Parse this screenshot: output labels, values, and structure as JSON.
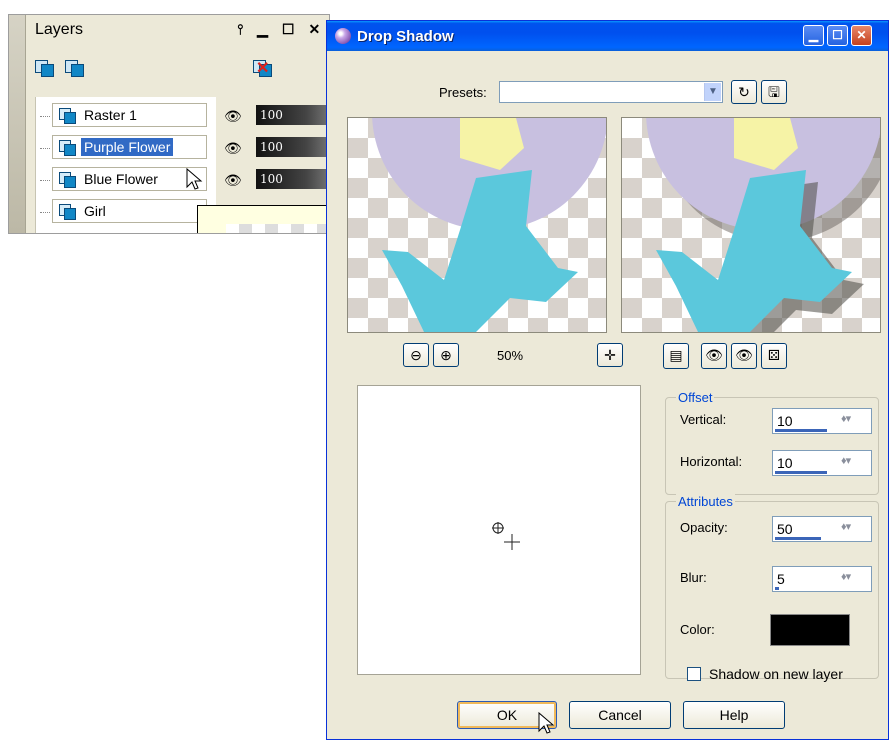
{
  "layers": {
    "title": "Layers",
    "rows": [
      {
        "name": "Raster 1",
        "opacity": "100"
      },
      {
        "name": "Purple Flower",
        "opacity": "100"
      },
      {
        "name": "Blue Flower",
        "opacity": "100"
      },
      {
        "name": "Girl",
        "opacity": ""
      }
    ],
    "selected_layer": "Purple Flower",
    "title_controls": [
      "pin-icon",
      "minimize-icon",
      "maximize-icon",
      "close-icon"
    ],
    "toolbar_icons": [
      "new-raster-layer-icon",
      "new-vector-layer-icon",
      "delete-layer-icon"
    ]
  },
  "dialog": {
    "title": "Drop Shadow",
    "presets_label": "Presets:",
    "presets_value": "",
    "zoom_level": "50%",
    "offset": {
      "group_label": "Offset",
      "vertical_label": "Vertical:",
      "vertical_value": "10",
      "horizontal_label": "Horizontal:",
      "horizontal_value": "10"
    },
    "attributes": {
      "group_label": "Attributes",
      "opacity_label": "Opacity:",
      "opacity_value": "50",
      "blur_label": "Blur:",
      "blur_value": "5",
      "color_label": "Color:",
      "color_value": "#000000"
    },
    "shadow_new_layer_label": "Shadow on new layer",
    "shadow_new_layer_checked": false,
    "buttons": {
      "ok": "OK",
      "cancel": "Cancel",
      "help": "Help"
    }
  },
  "colors": {
    "titlebar": "#0054e3",
    "selection": "#316ac5",
    "flower_petal": "#c8c0e0",
    "flower_center": "#f6f3a6",
    "stem": "#5bc8dc"
  }
}
